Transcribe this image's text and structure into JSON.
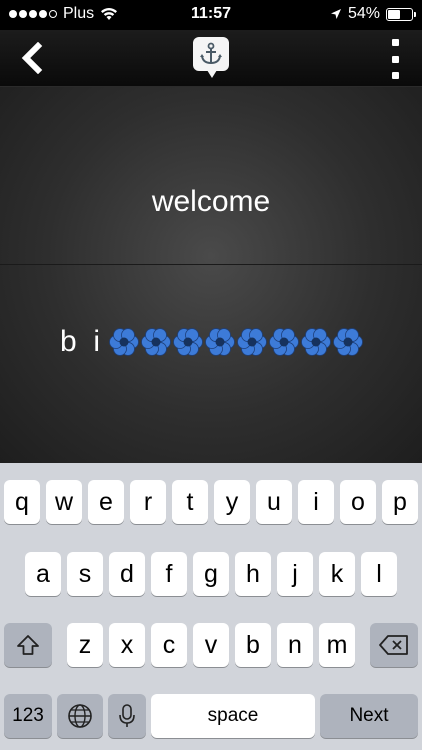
{
  "status_bar": {
    "carrier": "Plus",
    "time": "11:57",
    "battery_percent": "54%",
    "battery_level": 0.54
  },
  "nav": {
    "back_icon": "chevron-left-icon",
    "app_icon": "anchor-icon",
    "more_icon": "vertical-dots-icon"
  },
  "content": {
    "welcome": "welcome",
    "message_text": "b  i",
    "flower_count": 8,
    "flower_color": "#3d7bd8"
  },
  "keyboard": {
    "row1": [
      "q",
      "w",
      "e",
      "r",
      "t",
      "y",
      "u",
      "i",
      "o",
      "p"
    ],
    "row2": [
      "a",
      "s",
      "d",
      "f",
      "g",
      "h",
      "j",
      "k",
      "l"
    ],
    "row3": [
      "z",
      "x",
      "c",
      "v",
      "b",
      "n",
      "m"
    ],
    "numbers_label": "123",
    "space_label": "space",
    "next_label": "Next",
    "shift_icon": "shift-icon",
    "delete_icon": "backspace-icon",
    "globe_icon": "globe-icon",
    "mic_icon": "microphone-icon"
  }
}
